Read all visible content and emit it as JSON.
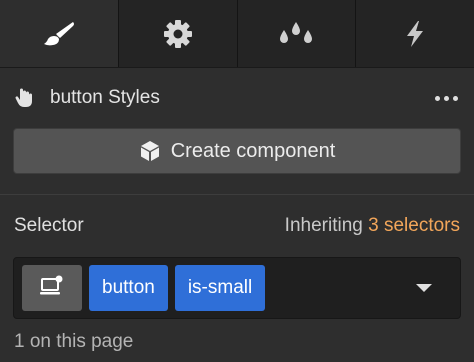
{
  "tabs": [
    {
      "name": "style",
      "icon": "paintbrush-icon",
      "active": true
    },
    {
      "name": "settings",
      "icon": "gear-icon",
      "active": false
    },
    {
      "name": "color",
      "icon": "droplets-icon",
      "active": false
    },
    {
      "name": "interactions",
      "icon": "lightning-icon",
      "active": false
    }
  ],
  "header": {
    "title": "button Styles",
    "more_icon": "more-dots-icon"
  },
  "create_component": {
    "label": "Create component",
    "icon": "cube-icon"
  },
  "selector": {
    "label": "Selector",
    "inheriting_prefix": "Inheriting ",
    "inheriting_count": "3 selectors",
    "inheriting_color": "#f2a65a",
    "chips": [
      "button",
      "is-small"
    ],
    "chip_color": "#2f6fd8",
    "usage_note": "1 on this page"
  }
}
